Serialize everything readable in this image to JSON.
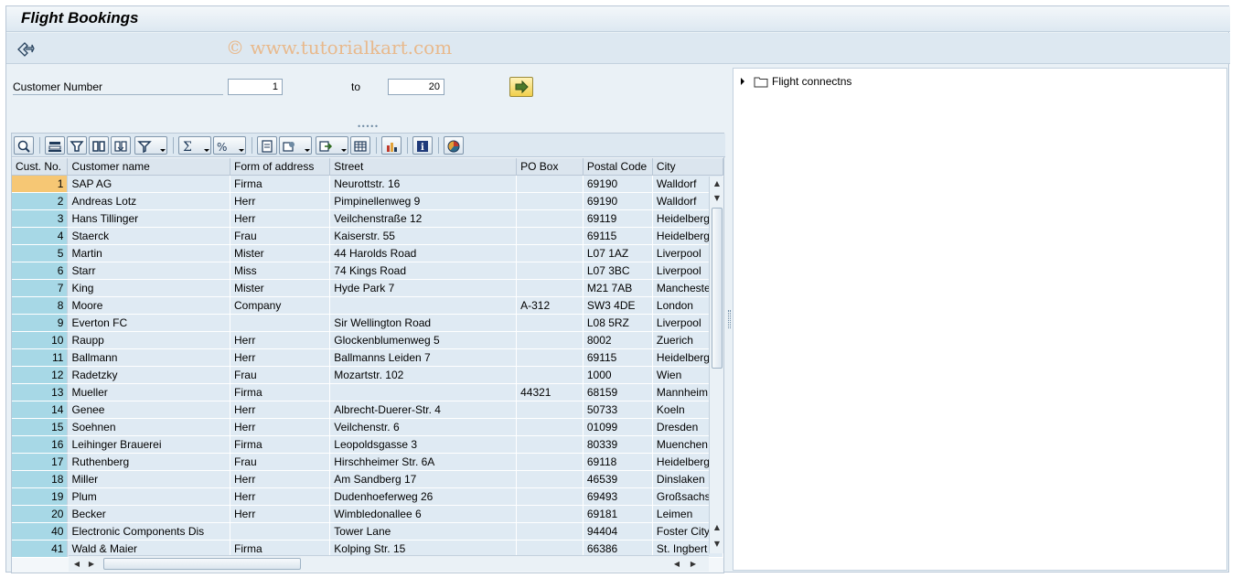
{
  "window": {
    "title": "Flight Bookings"
  },
  "watermark": "© www.tutorialkart.com",
  "selection": {
    "customer_number_label": "Customer Number",
    "from_value": "1",
    "to_label": "to",
    "to_value": "20"
  },
  "toolbar": {
    "icons": [
      "details-icon",
      "sort-ascending-icon",
      "sort-descending-icon",
      "find-icon",
      "find-next-icon",
      "filter-icon",
      "total-icon",
      "subtotal-icon",
      "print-icon",
      "views-icon",
      "export-icon",
      "layout-icon",
      "graphic-icon",
      "info-icon",
      "abc-analysis-icon"
    ]
  },
  "table": {
    "columns": [
      "Cust. No.",
      "Customer name",
      "Form of address",
      "Street",
      "PO Box",
      "Postal Code",
      "City"
    ],
    "rows": [
      [
        "1",
        "SAP AG",
        "Firma",
        "Neurottstr. 16",
        "",
        "69190",
        "Walldorf"
      ],
      [
        "2",
        "Andreas Lotz",
        "Herr",
        "Pimpinellenweg 9",
        "",
        "69190",
        "Walldorf"
      ],
      [
        "3",
        "Hans Tillinger",
        "Herr",
        "Veilchenstraße 12",
        "",
        "69119",
        "Heidelberg"
      ],
      [
        "4",
        "Staerck",
        "Frau",
        "Kaiserstr. 55",
        "",
        "69115",
        "Heidelberg"
      ],
      [
        "5",
        "Martin",
        "Mister",
        "44 Harolds Road",
        "",
        "L07 1AZ",
        "Liverpool"
      ],
      [
        "6",
        "Starr",
        "Miss",
        "74 Kings Road",
        "",
        "L07 3BC",
        "Liverpool"
      ],
      [
        "7",
        "King",
        "Mister",
        "Hyde Park 7",
        "",
        "M21 7AB",
        "Manchester"
      ],
      [
        "8",
        "Moore",
        "Company",
        "",
        "A-312",
        "SW3 4DE",
        "London"
      ],
      [
        "9",
        "Everton FC",
        "",
        "Sir Wellington Road",
        "",
        "L08 5RZ",
        "Liverpool"
      ],
      [
        "10",
        "Raupp",
        "Herr",
        "Glockenblumenweg 5",
        "",
        "8002",
        "Zuerich"
      ],
      [
        "11",
        "Ballmann",
        "Herr",
        "Ballmanns Leiden 7",
        "",
        "69115",
        "Heidelberg"
      ],
      [
        "12",
        "Radetzky",
        "Frau",
        "Mozartstr. 102",
        "",
        "1000",
        "Wien"
      ],
      [
        "13",
        "Mueller",
        "Firma",
        "",
        "44321",
        "68159",
        "Mannheim"
      ],
      [
        "14",
        "Genee",
        "Herr",
        "Albrecht-Duerer-Str. 4",
        "",
        "50733",
        "Koeln"
      ],
      [
        "15",
        "Soehnen",
        "Herr",
        "Veilchenstr. 6",
        "",
        "01099",
        "Dresden"
      ],
      [
        "16",
        "Leihinger Brauerei",
        "Firma",
        "Leopoldsgasse 3",
        "",
        "80339",
        "Muenchen"
      ],
      [
        "17",
        "Ruthenberg",
        "Frau",
        "Hirschheimer Str. 6A",
        "",
        "69118",
        "Heidelberg"
      ],
      [
        "18",
        "Miller",
        "Herr",
        "Am Sandberg 17",
        "",
        "46539",
        "Dinslaken"
      ],
      [
        "19",
        "Plum",
        "Herr",
        "Dudenhoeferweg 26",
        "",
        "69493",
        "Großsachsen"
      ],
      [
        "20",
        "Becker",
        "Herr",
        "Wimbledonallee 6",
        "",
        "69181",
        "Leimen"
      ],
      [
        "40",
        "Electronic Components Dis",
        "",
        "Tower Lane",
        "",
        "94404",
        "Foster City"
      ],
      [
        "41",
        "Wald & Maier",
        "Firma",
        "Kolping Str. 15",
        "",
        "66386",
        "St. Ingbert"
      ]
    ]
  },
  "tree": {
    "node_label": "Flight connectns"
  }
}
